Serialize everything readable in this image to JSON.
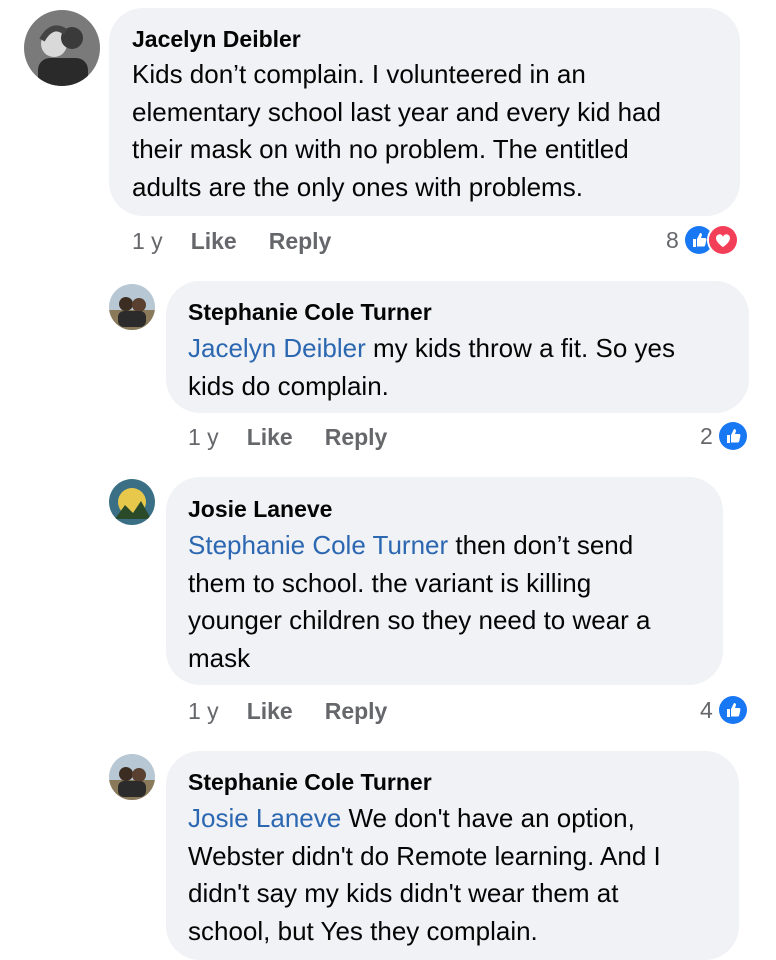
{
  "comments": [
    {
      "author": "Jacelyn Deibler",
      "mention": "",
      "lines": [
        "Kids don’t complain. I volunteered in an",
        "elementary school last year and every kid had",
        "their mask on with no problem. The entitled",
        "adults are the only ones with problems."
      ],
      "time": "1 y",
      "like": "Like",
      "reply": "Reply",
      "reaction_count": "8",
      "reactions": [
        "like-reaction-icon",
        "love-reaction-icon"
      ]
    },
    {
      "author": "Stephanie Cole Turner",
      "mention": "Jacelyn Deibler",
      "lines": [
        " my kids throw a fit. So yes",
        "kids do complain."
      ],
      "time": "1 y",
      "like": "Like",
      "reply": "Reply",
      "reaction_count": "2",
      "reactions": [
        "like-reaction-icon"
      ]
    },
    {
      "author": "Josie Laneve",
      "mention": "Stephanie Cole Turner",
      "lines": [
        " then don’t send",
        "them to school. the variant is killing",
        "younger children so they need to wear a",
        "mask"
      ],
      "time": "1 y",
      "like": "Like",
      "reply": "Reply",
      "reaction_count": "4",
      "reactions": [
        "like-reaction-icon"
      ]
    },
    {
      "author": "Stephanie Cole Turner",
      "mention": "Josie Laneve",
      "lines": [
        " We don't have an option,",
        "Webster didn't do Remote learning. And I",
        "didn't say my kids didn't wear them at",
        "school, but Yes they complain."
      ],
      "time": "",
      "like": "",
      "reply": "",
      "reaction_count": "",
      "reactions": []
    }
  ],
  "colors": {
    "bubble": "#f0f2f5",
    "mention": "#2c67b1",
    "like_blue": "#1877f2",
    "love_red": "#f33e58",
    "meta_gray": "#65676b"
  }
}
